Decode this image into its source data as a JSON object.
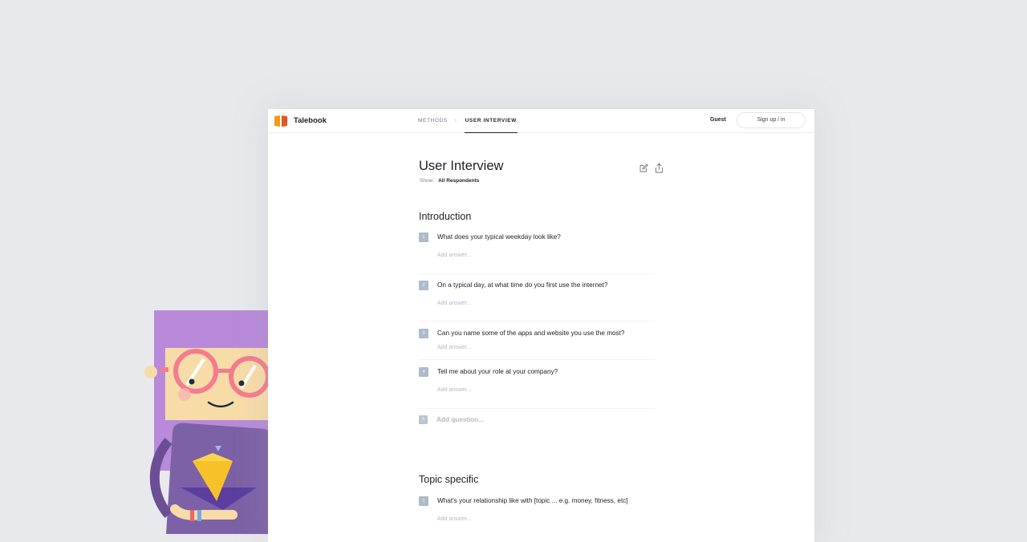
{
  "app": {
    "brand_name": "Talebook",
    "accent_color": "#f39a1c"
  },
  "nav": {
    "breadcrumb": [
      "METHODS",
      "USER INTERVIEW"
    ],
    "separator": "›",
    "guest_label": "Guest",
    "signup_label": "Sign up / in"
  },
  "page": {
    "title": "User Interview",
    "show_label": "Show:",
    "show_value": "All Respondents",
    "icons": [
      "edit-icon",
      "share-icon"
    ]
  },
  "sections": [
    {
      "title": "Introduction",
      "questions": [
        {
          "num": "1",
          "text": "What does your typical weekday look like?",
          "answer_placeholder": "Add answer..."
        },
        {
          "num": "2",
          "text": "On a typical day, at what time do you first use the internet?",
          "answer_placeholder": "Add answer..."
        },
        {
          "num": "3",
          "text": "Can you name some of the apps and website you use the most?",
          "answer_placeholder": "Add answer..."
        },
        {
          "num": "4",
          "text": "Tell me about your role at your company?",
          "answer_placeholder": "Add answer..."
        }
      ],
      "add_question": {
        "num": "5",
        "label": "Add question..."
      }
    },
    {
      "title": "Topic specific",
      "questions": [
        {
          "num": "1",
          "text": "What's your relationship like with [topic ... e.g. money, fitness, etc]",
          "answer_placeholder": "Add answer..."
        }
      ]
    }
  ]
}
